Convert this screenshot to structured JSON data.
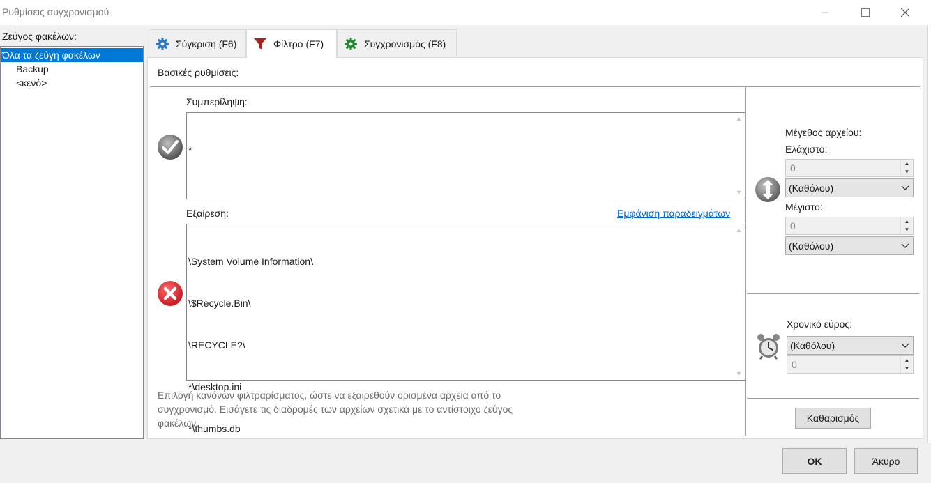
{
  "window": {
    "title": "Ρυθμίσεις συγχρονισμού",
    "min_icon": "minimize-icon",
    "max_icon": "maximize-icon",
    "close_icon": "close-icon"
  },
  "pairs": {
    "label": "Ζεύγος φακέλων:",
    "items": [
      "Όλα τα ζεύγη φακέλων",
      "Backup",
      "<κενό>"
    ],
    "selected_index": 0
  },
  "tabs": [
    {
      "label": "Σύγκριση (F6)",
      "icon": "gear-icon",
      "active": false
    },
    {
      "label": "Φίλτρο (F7)",
      "icon": "funnel-icon",
      "active": true
    },
    {
      "label": "Συγχρονισμός (F8)",
      "icon": "sync-gear-icon",
      "active": false
    }
  ],
  "filter": {
    "basic_label": "Βασικές ρυθμίσεις:",
    "include_label": "Συμπερίληψη:",
    "include_lines": [
      "*"
    ],
    "exclude_label": "Εξαίρεση:",
    "examples_link": "Εμφάνιση παραδειγμάτων",
    "exclude_lines": [
      "\\System Volume Information\\",
      "\\$Recycle.Bin\\",
      "\\RECYCLE?\\",
      "*\\desktop.ini",
      "*\\thumbs.db"
    ],
    "hint": "Επιλογή κανόνων φιλτραρίσματος, ώστε να εξαιρεθούν ορισμένα αρχεία από το συγχρονισμό. Εισάγετε τις διαδρομές των αρχείων σχετικά με το αντίστοιχο ζεύγος φακέλων."
  },
  "size": {
    "label": "Μέγεθος αρχείου:",
    "min_label": "Ελάχιστο:",
    "min_value": "0",
    "min_unit": "(Καθόλου)",
    "max_label": "Μέγιστο:",
    "max_value": "0",
    "max_unit": "(Καθόλου)"
  },
  "time": {
    "label": "Χρονικό εύρος:",
    "unit": "(Καθόλου)",
    "value": "0"
  },
  "buttons": {
    "clear": "Καθαρισμός",
    "ok": "OK",
    "cancel": "Άκυρο"
  },
  "colors": {
    "selection": "#0078d7",
    "link": "#0066cc",
    "check_icon": "#6e6e6e",
    "cross_icon": "#d9232e",
    "funnel_icon": "#b3201c",
    "sync_icon": "#1e8a2e",
    "gear_icon": "#2a76c7"
  }
}
